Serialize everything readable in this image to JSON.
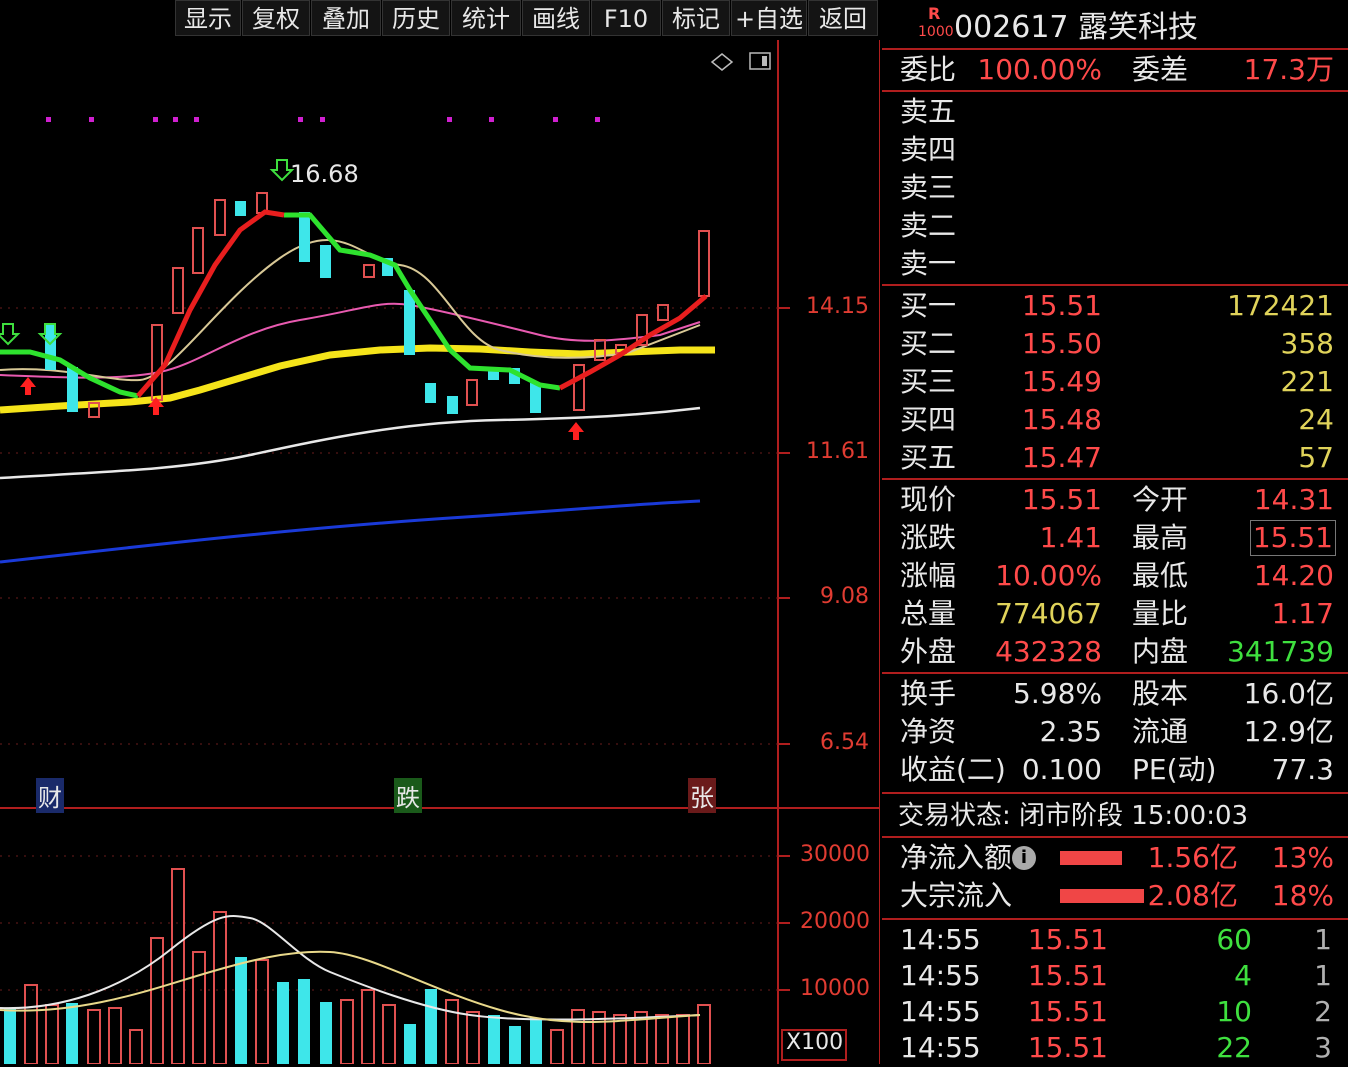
{
  "toolbar": {
    "buttons": [
      "显示",
      "复权",
      "叠加",
      "历史",
      "统计",
      "画线",
      "F10",
      "标记",
      "+自选",
      "返回"
    ]
  },
  "chart": {
    "peak_label": "16.68",
    "price_axis": [
      "14.15",
      "11.61",
      "9.08",
      "6.54"
    ],
    "volume_axis": [
      "30000",
      "20000",
      "10000"
    ],
    "volume_unit": "X100",
    "flags": {
      "cai": "财",
      "die": "跌",
      "zhang": "张"
    }
  },
  "header": {
    "badge_top": "R",
    "badge_bottom": "1000",
    "code_name": "002617 露笑科技"
  },
  "weibi": {
    "label1": "委比",
    "value1": "100.00%",
    "label2": "委差",
    "value2": "17.3万"
  },
  "sell": [
    {
      "label": "卖五"
    },
    {
      "label": "卖四"
    },
    {
      "label": "卖三"
    },
    {
      "label": "卖二"
    },
    {
      "label": "卖一"
    }
  ],
  "buy": [
    {
      "label": "买一",
      "price": "15.51",
      "vol": "172421"
    },
    {
      "label": "买二",
      "price": "15.50",
      "vol": "358"
    },
    {
      "label": "买三",
      "price": "15.49",
      "vol": "221"
    },
    {
      "label": "买四",
      "price": "15.48",
      "vol": "24"
    },
    {
      "label": "买五",
      "price": "15.47",
      "vol": "57"
    }
  ],
  "quote": [
    {
      "l1": "现价",
      "v1": "15.51",
      "l2": "今开",
      "v2": "14.31"
    },
    {
      "l1": "涨跌",
      "v1": "1.41",
      "l2": "最高",
      "v2": "15.51"
    },
    {
      "l1": "涨幅",
      "v1": "10.00%",
      "l2": "最低",
      "v2": "14.20"
    },
    {
      "l1": "总量",
      "v1": "774067",
      "l2": "量比",
      "v2": "1.17"
    },
    {
      "l1": "外盘",
      "v1": "432328",
      "l2": "内盘",
      "v2": "341739"
    }
  ],
  "finance": [
    {
      "l1": "换手",
      "v1": "5.98%",
      "l2": "股本",
      "v2": "16.0亿"
    },
    {
      "l1": "净资",
      "v1": "2.35",
      "l2": "流通",
      "v2": "12.9亿"
    },
    {
      "l1": "收益(二)",
      "v1": "0.100",
      "l2": "PE(动)",
      "v2": "77.3"
    }
  ],
  "status": {
    "text": "交易状态: 闭市阶段 15:00:03"
  },
  "flow": [
    {
      "label": "净流入额",
      "amount": "1.56亿",
      "pct": "13%",
      "bar": 0.55
    },
    {
      "label": "大宗流入",
      "amount": "2.08亿",
      "pct": "18%",
      "bar": 0.75
    }
  ],
  "ticks": [
    {
      "time": "14:55",
      "price": "15.51",
      "vol": "60",
      "n": "1"
    },
    {
      "time": "14:55",
      "price": "15.51",
      "vol": "4",
      "n": "1"
    },
    {
      "time": "14:55",
      "price": "15.51",
      "vol": "10",
      "n": "2"
    },
    {
      "time": "14:55",
      "price": "15.51",
      "vol": "22",
      "n": "3"
    }
  ]
}
